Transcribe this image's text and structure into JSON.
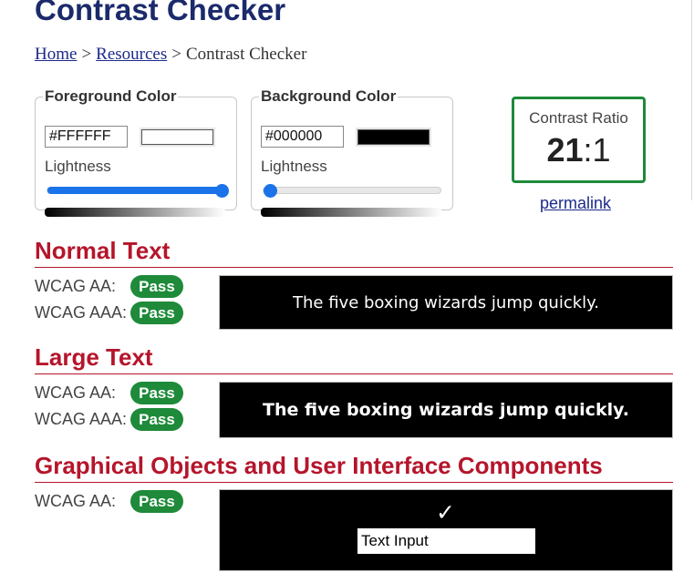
{
  "page": {
    "title": "Contrast Checker"
  },
  "breadcrumb": {
    "home": "Home",
    "resources": "Resources",
    "current": "Contrast Checker",
    "separator": ">"
  },
  "foreground": {
    "legend": "Foreground Color",
    "hex": "#FFFFFF",
    "swatch_color": "#ffffff",
    "lightness_label": "Lightness",
    "lightness_value_percent": 100
  },
  "background": {
    "legend": "Background Color",
    "hex": "#000000",
    "swatch_color": "#000000",
    "lightness_label": "Lightness",
    "lightness_value_percent": 0
  },
  "ratio": {
    "label": "Contrast Ratio",
    "value_main": "21",
    "value_rest": ":1",
    "permalink": "permalink"
  },
  "normal_text": {
    "heading": "Normal Text",
    "aa_label": "WCAG AA:",
    "aa_result": "Pass",
    "aaa_label": "WCAG AAA:",
    "aaa_result": "Pass",
    "sample": "The five boxing wizards jump quickly."
  },
  "large_text": {
    "heading": "Large Text",
    "aa_label": "WCAG AA:",
    "aa_result": "Pass",
    "aaa_label": "WCAG AAA:",
    "aaa_result": "Pass",
    "sample": "The five boxing wizards jump quickly."
  },
  "graphics": {
    "heading": "Graphical Objects and User Interface Components",
    "aa_label": "WCAG AA:",
    "aa_result": "Pass",
    "check_icon": "checkmark-icon",
    "text_input": "Text Input"
  },
  "colors": {
    "heading": "#b5152b",
    "title": "#1b2a6b",
    "pass": "#1e8a3a",
    "slider": "#1a73e8"
  }
}
